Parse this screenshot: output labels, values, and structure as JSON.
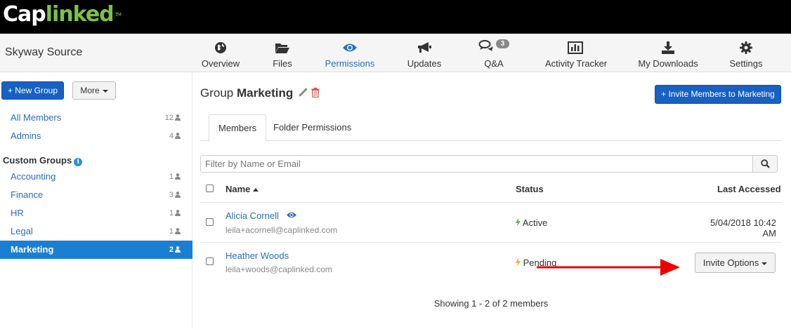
{
  "brand": {
    "logo_part1": "Cap",
    "logo_part2": "linked",
    "logo_tm": "TM"
  },
  "header": {
    "company": "Skyway Source"
  },
  "nav": {
    "items": [
      {
        "label": "Overview",
        "icon": "globe-icon"
      },
      {
        "label": "Files",
        "icon": "folder-open-icon"
      },
      {
        "label": "Permissions",
        "icon": "eye-icon",
        "active": true
      },
      {
        "label": "Updates",
        "icon": "megaphone-icon"
      },
      {
        "label": "Q&A",
        "icon": "comments-icon",
        "badge": "3"
      },
      {
        "label": "Activity Tracker",
        "icon": "bar-chart-icon"
      },
      {
        "label": "My Downloads",
        "icon": "download-icon"
      },
      {
        "label": "Settings",
        "icon": "gear-icon"
      }
    ]
  },
  "sidebar": {
    "new_group_label": "+ New Group",
    "more_label": "More",
    "default_groups": [
      {
        "name": "All Members",
        "count": "12"
      },
      {
        "name": "Admins",
        "count": "4"
      }
    ],
    "custom_heading": "Custom Groups",
    "custom_groups": [
      {
        "name": "Accounting",
        "count": "1"
      },
      {
        "name": "Finance",
        "count": "3"
      },
      {
        "name": "HR",
        "count": "1"
      },
      {
        "name": "Legal",
        "count": "1"
      },
      {
        "name": "Marketing",
        "count": "2",
        "active": true
      }
    ]
  },
  "main": {
    "title_prefix": "Group",
    "group_name": "Marketing",
    "invite_button_label": "+ Invite Members to Marketing",
    "tabs": [
      {
        "label": "Members",
        "active": true
      },
      {
        "label": "Folder Permissions"
      }
    ],
    "filter_placeholder": "Filter by Name or Email",
    "columns": {
      "name": "Name",
      "status": "Status",
      "last_accessed": "Last Accessed"
    },
    "members": [
      {
        "name": "Alicia Cornell",
        "email": "leila+acornell@caplinked.com",
        "status": "Active",
        "last_accessed": "5/04/2018 10:42 AM"
      },
      {
        "name": "Heather Woods",
        "email": "leila+woods@caplinked.com",
        "status": "Pending",
        "invite_options_label": "Invite Options"
      }
    ],
    "showing": "Showing 1 - 2 of 2 members"
  },
  "colors": {
    "accent": "#2a6ebb",
    "primary_button": "#1760c4",
    "active_group": "#1a7fd3",
    "logo_green": "#7cc242",
    "status_active": "#5cb85c",
    "status_pending": "#f0ad4e",
    "annotation_arrow": "#ee0000"
  }
}
